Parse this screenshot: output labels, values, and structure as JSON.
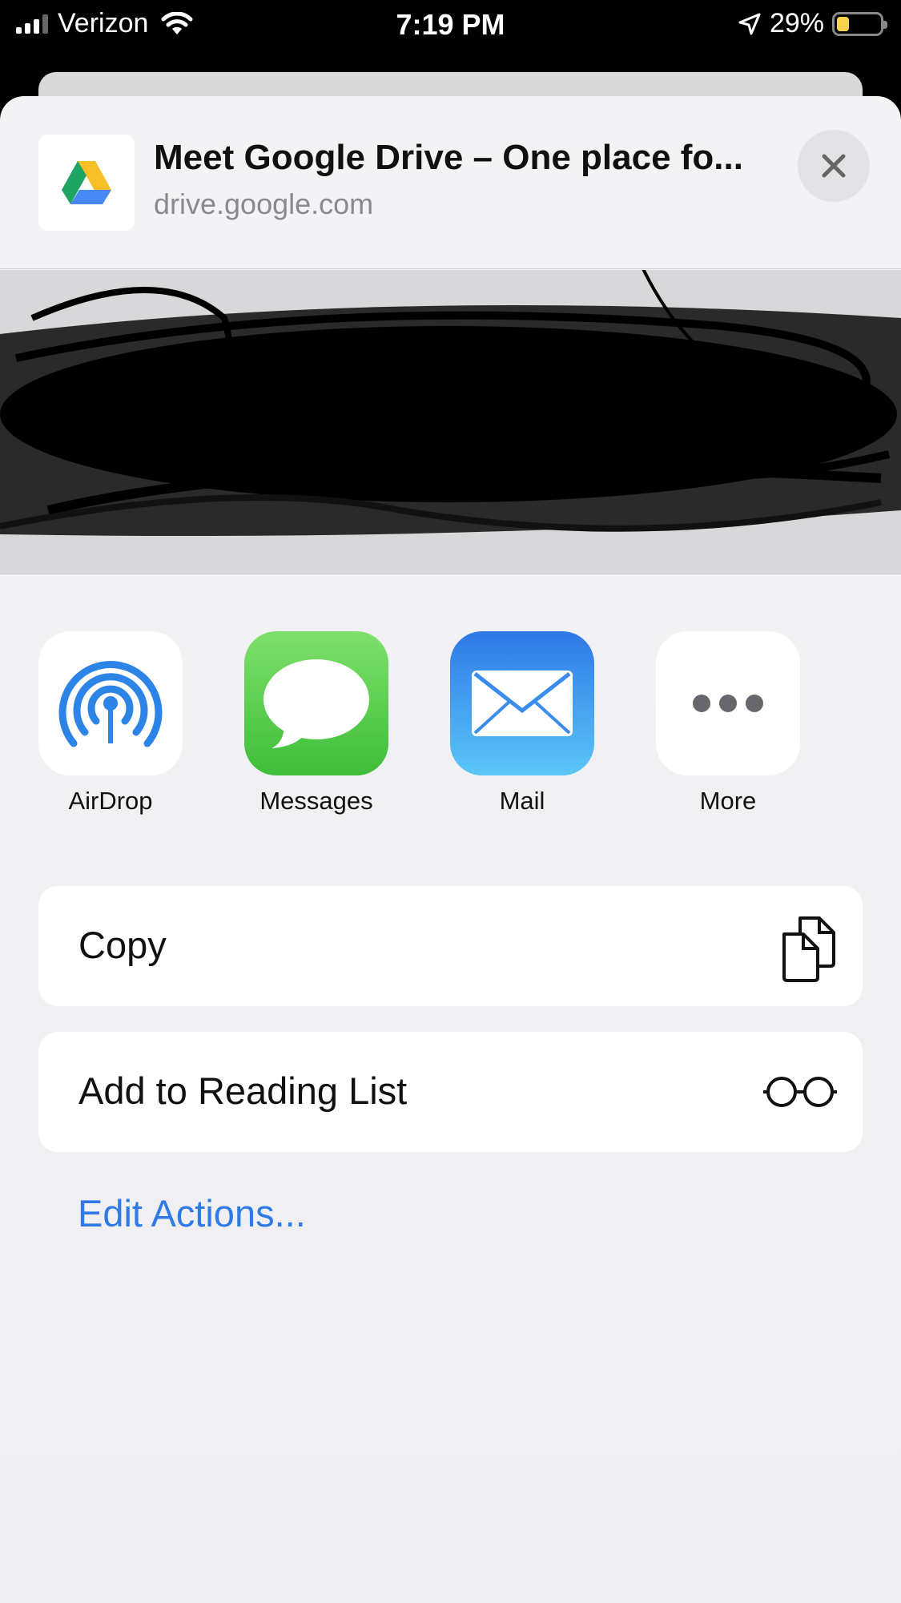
{
  "status_bar": {
    "carrier": "Verizon",
    "time": "7:19 PM",
    "battery": "29%",
    "battery_level": 0.29
  },
  "share_header": {
    "title": "Meet Google Drive – One place fo...",
    "url": "drive.google.com"
  },
  "apps": [
    {
      "label": "AirDrop",
      "icon": "airdrop-icon"
    },
    {
      "label": "Messages",
      "icon": "messages-icon"
    },
    {
      "label": "Mail",
      "icon": "mail-icon"
    },
    {
      "label": "More",
      "icon": "more-icon"
    }
  ],
  "actions": [
    {
      "label": "Copy",
      "icon": "copy-icon"
    },
    {
      "label": "Add to Reading List",
      "icon": "glasses-icon"
    }
  ],
  "edit_actions": "Edit Actions..."
}
